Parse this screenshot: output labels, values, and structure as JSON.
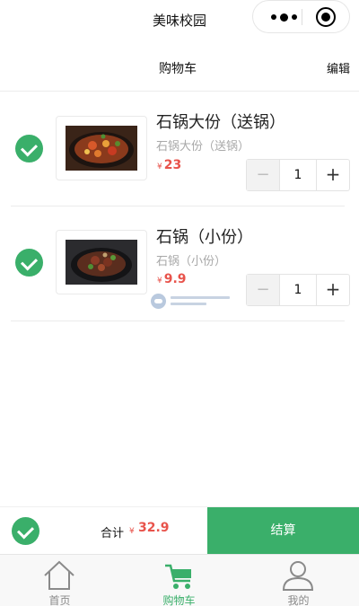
{
  "navbar": {
    "title": "美味校园",
    "menu_icon": "more-dots-icon",
    "close_icon": "target-circle-icon"
  },
  "cart": {
    "title": "购物车",
    "edit_label": "编辑"
  },
  "items": [
    {
      "name": "石锅大份（送锅）",
      "subtitle": "石锅大份（送锅）",
      "currency": "¥",
      "price": "23",
      "quantity": "1",
      "minus": "−",
      "plus": "+",
      "checked": true
    },
    {
      "name": "石锅（小份）",
      "subtitle": "石锅（小份）",
      "currency": "¥",
      "price": "9.9",
      "quantity": "1",
      "minus": "−",
      "plus": "+",
      "checked": true
    }
  ],
  "footer": {
    "select_all_checked": true,
    "total_label": "合计",
    "currency": "¥",
    "total_value": "32.9",
    "checkout_label": "结算"
  },
  "tabbar": [
    {
      "label": "首页",
      "icon": "home-icon",
      "active": false
    },
    {
      "label": "购物车",
      "icon": "cart-icon",
      "active": true
    },
    {
      "label": "我的",
      "icon": "user-icon",
      "active": false
    }
  ],
  "colors": {
    "accent": "#3aaf6a",
    "price": "#e8534b",
    "muted_text": "#a8a8a8"
  }
}
